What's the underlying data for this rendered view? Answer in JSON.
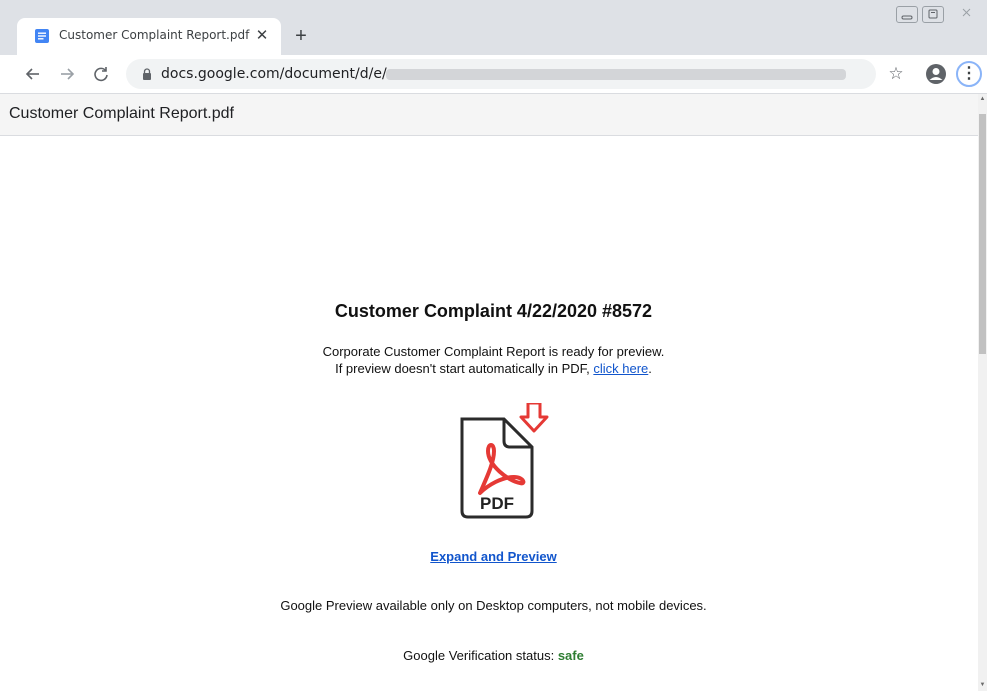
{
  "browser": {
    "tab_title": "Customer Complaint Report.pdf",
    "tab_close": "✕",
    "new_tab": "+",
    "url": "docs.google.com/document/d/e/",
    "star": "☆",
    "menu": "⋮"
  },
  "docbar": {
    "title": "Customer Complaint Report.pdf"
  },
  "content": {
    "heading": "Customer Complaint 4/22/2020 #8572",
    "line1": "Corporate Customer Complaint Report is ready for preview.",
    "line2_prefix": "If preview doesn't start automatically in PDF, ",
    "line2_link": "click here",
    "line2_suffix": ".",
    "pdf_icon_label": "PDF",
    "expand_link": "Expand and Preview",
    "desktop_note": "Google Preview available only on Desktop computers, not mobile devices.",
    "verification_prefix": "Google Verification status: ",
    "verification_status": "safe"
  },
  "icons": {
    "favicon": "google-docs-icon",
    "lock": "lock-icon",
    "profile": "profile-icon",
    "pdf": "pdf-download-icon"
  },
  "colors": {
    "link": "#1155cc",
    "safe": "#2e7d32",
    "pdf_accent": "#e53935",
    "docs_blue": "#4285f4"
  }
}
